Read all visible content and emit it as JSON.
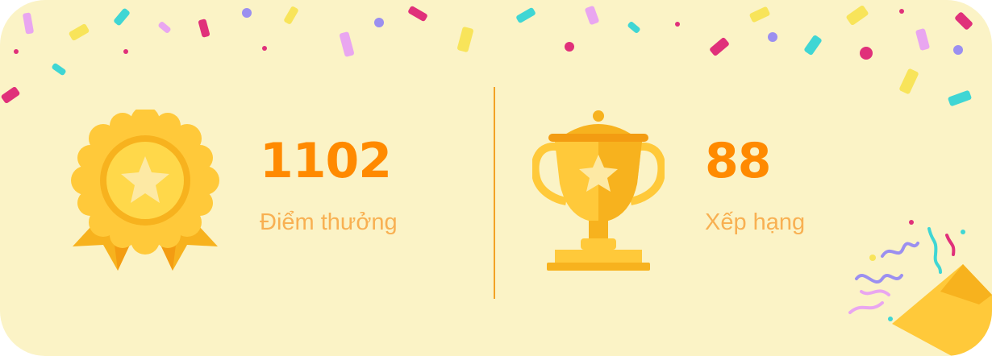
{
  "rewards": {
    "points": {
      "value": "1102",
      "label": "Điểm thưởng",
      "icon": "medal-icon"
    },
    "ranking": {
      "value": "88",
      "label": "Xếp hạng",
      "icon": "trophy-icon"
    }
  },
  "colors": {
    "background": "#fbf3c6",
    "value": "#ff8a00",
    "label": "#f8b052",
    "divider": "#f2a125",
    "gold": "#ffc93a",
    "gold_dark": "#f6a81c"
  },
  "decorations": {
    "confetti": "confetti-decoration",
    "party_popper": "party-popper-icon"
  }
}
